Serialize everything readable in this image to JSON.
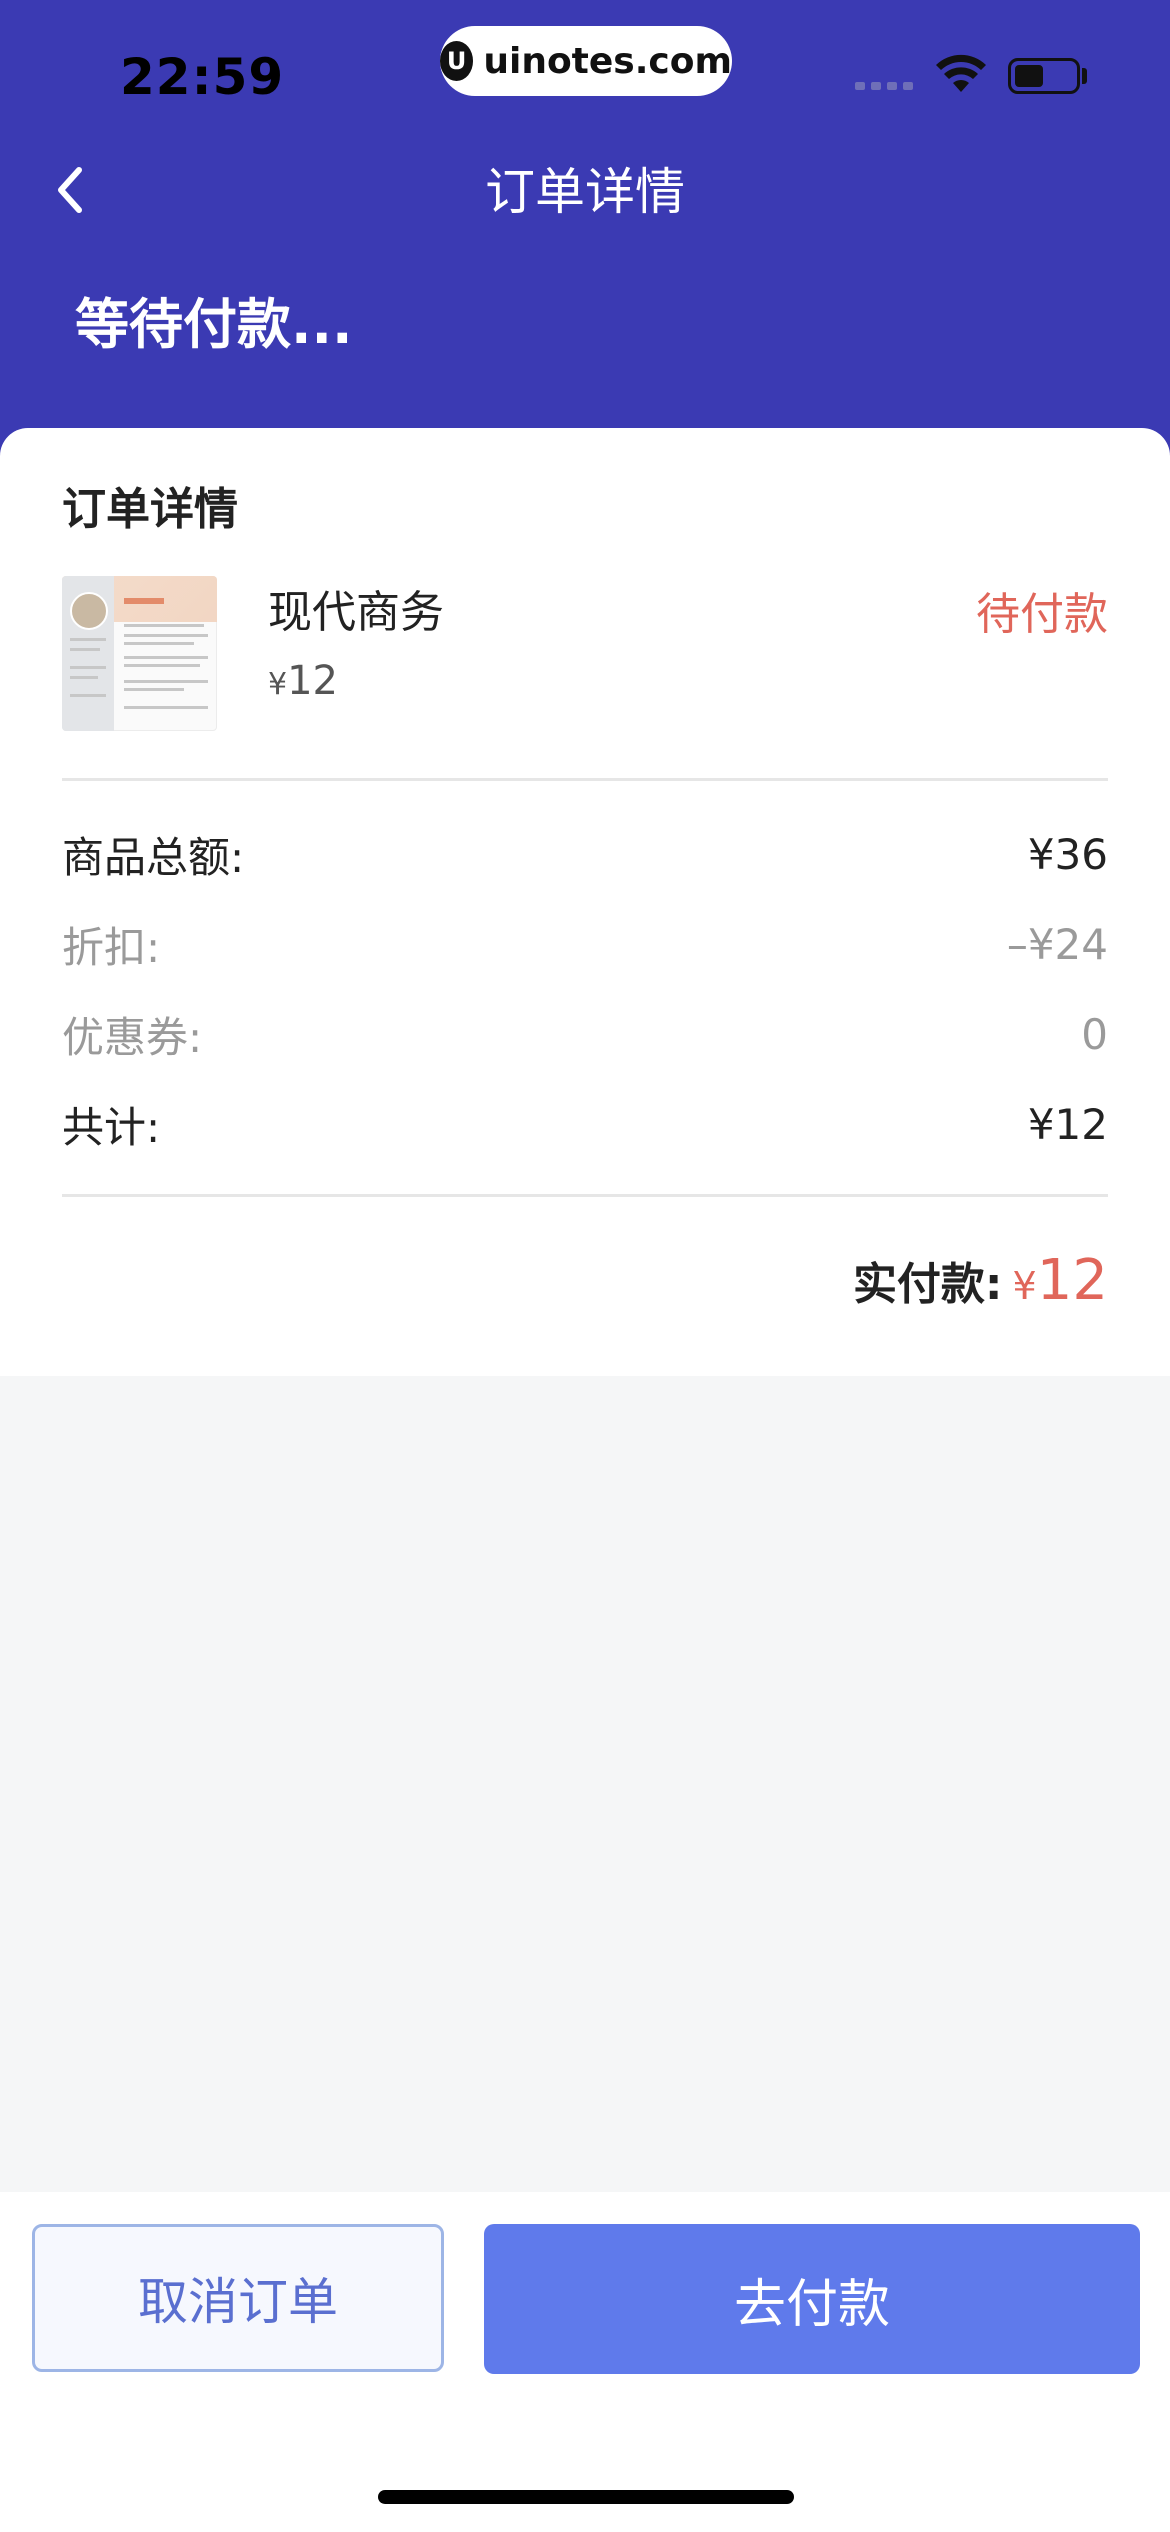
{
  "status_bar": {
    "time": "22:59",
    "url": "uinotes.com"
  },
  "nav": {
    "title": "订单详情"
  },
  "order_status_heading": "等待付款...",
  "card": {
    "title": "订单详情",
    "product": {
      "name": "现代商务",
      "price_currency": "¥",
      "price": "12",
      "status": "待付款"
    },
    "summary": [
      {
        "label": "商品总额:",
        "value": "¥36",
        "tone": "dark"
      },
      {
        "label": "折扣:",
        "value": "–¥24",
        "tone": "muted"
      },
      {
        "label": "优惠券:",
        "value": "0",
        "tone": "muted"
      },
      {
        "label": "共计:",
        "value": "¥12",
        "tone": "dark"
      }
    ],
    "paid": {
      "label": "实付款:",
      "currency": "¥",
      "amount": "12"
    }
  },
  "actions": {
    "cancel_label": "取消订单",
    "pay_label": "去付款"
  },
  "colors": {
    "header_bg": "#3b3ab3",
    "accent_red": "#e0665a",
    "pay_button": "#5f7aeb"
  }
}
